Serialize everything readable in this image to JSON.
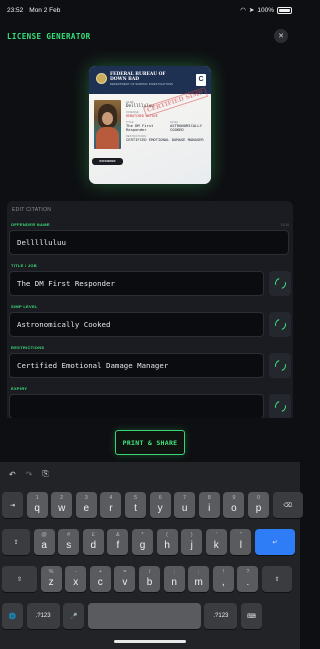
{
  "status": {
    "time": "23:52",
    "date": "Mon 2 Feb",
    "battery": "100%"
  },
  "header": {
    "title": "LICENSE GENERATOR",
    "close_icon": "close-icon"
  },
  "license": {
    "bureau": "FEDERAL BUREAU OF DOWN BAD",
    "department": "DEPARTMENT OF SIMPING INVESTIGATIONS",
    "class": "C",
    "name_label": "NAME",
    "name": "Dellllluluu",
    "offense_label": "OFFENSE",
    "offense": "REMATCHED OCTAVE",
    "title_label": "TITLE",
    "title": "The DM First Responder",
    "level_label": "LEVEL",
    "level": "ASTRONOMICALLY COOKED",
    "restrictions_label": "RESTRICTIONS",
    "restrictions": "CERTIFIED EMOTIONAL DAMAGE MANAGER",
    "badge": "OFFENDER",
    "stamp": "CERTIFIED SIMP"
  },
  "form": {
    "section_title": "EDIT CITATION",
    "fields": [
      {
        "label": "OFFENDER NAME",
        "value": "Dellllluluu",
        "counter": "11/18"
      },
      {
        "label": "TITLE / JOB",
        "value": "The DM First Responder"
      },
      {
        "label": "SIMP LEVEL",
        "value": "Astronomically Cooked"
      },
      {
        "label": "RESTRICTIONS",
        "value": "Certified Emotional Damage Manager"
      },
      {
        "label": "EXPIRY",
        "value": ""
      }
    ]
  },
  "actions": {
    "print": "PRINT & SHARE"
  },
  "keyboard": {
    "toolbar": [
      "↶",
      "↷",
      "⎘"
    ],
    "row1": [
      {
        "main": "⇥",
        "sub": ""
      },
      {
        "main": "q",
        "sub": "1"
      },
      {
        "main": "w",
        "sub": "2"
      },
      {
        "main": "e",
        "sub": "3"
      },
      {
        "main": "r",
        "sub": "4"
      },
      {
        "main": "t",
        "sub": "5"
      },
      {
        "main": "y",
        "sub": "6"
      },
      {
        "main": "u",
        "sub": "7"
      },
      {
        "main": "i",
        "sub": "8"
      },
      {
        "main": "o",
        "sub": "9"
      },
      {
        "main": "p",
        "sub": "0"
      },
      {
        "main": "⌫",
        "sub": ""
      }
    ],
    "row2": [
      {
        "main": "⇪",
        "sub": ""
      },
      {
        "main": "a",
        "sub": "@"
      },
      {
        "main": "s",
        "sub": "#"
      },
      {
        "main": "d",
        "sub": "£"
      },
      {
        "main": "f",
        "sub": "&"
      },
      {
        "main": "g",
        "sub": "*"
      },
      {
        "main": "h",
        "sub": "("
      },
      {
        "main": "j",
        "sub": ")"
      },
      {
        "main": "k",
        "sub": "'"
      },
      {
        "main": "l",
        "sub": "\""
      },
      {
        "main": "↵",
        "sub": ""
      }
    ],
    "row3": [
      {
        "main": "⇧",
        "sub": ""
      },
      {
        "main": "z",
        "sub": "%"
      },
      {
        "main": "x",
        "sub": "-"
      },
      {
        "main": "c",
        "sub": "+"
      },
      {
        "main": "v",
        "sub": "="
      },
      {
        "main": "b",
        "sub": "/"
      },
      {
        "main": "n",
        "sub": ";"
      },
      {
        "main": "m",
        "sub": ":"
      },
      {
        "main": ",",
        "sub": "!"
      },
      {
        "main": ".",
        "sub": "?"
      },
      {
        "main": "⇧",
        "sub": ""
      }
    ],
    "row4": [
      {
        "main": "🌐",
        "sub": ""
      },
      {
        "main": ".?123",
        "sub": ""
      },
      {
        "main": "🎤",
        "sub": ""
      },
      {
        "main": "",
        "sub": ""
      },
      {
        "main": ".?123",
        "sub": ""
      },
      {
        "main": "⌨",
        "sub": ""
      }
    ]
  }
}
